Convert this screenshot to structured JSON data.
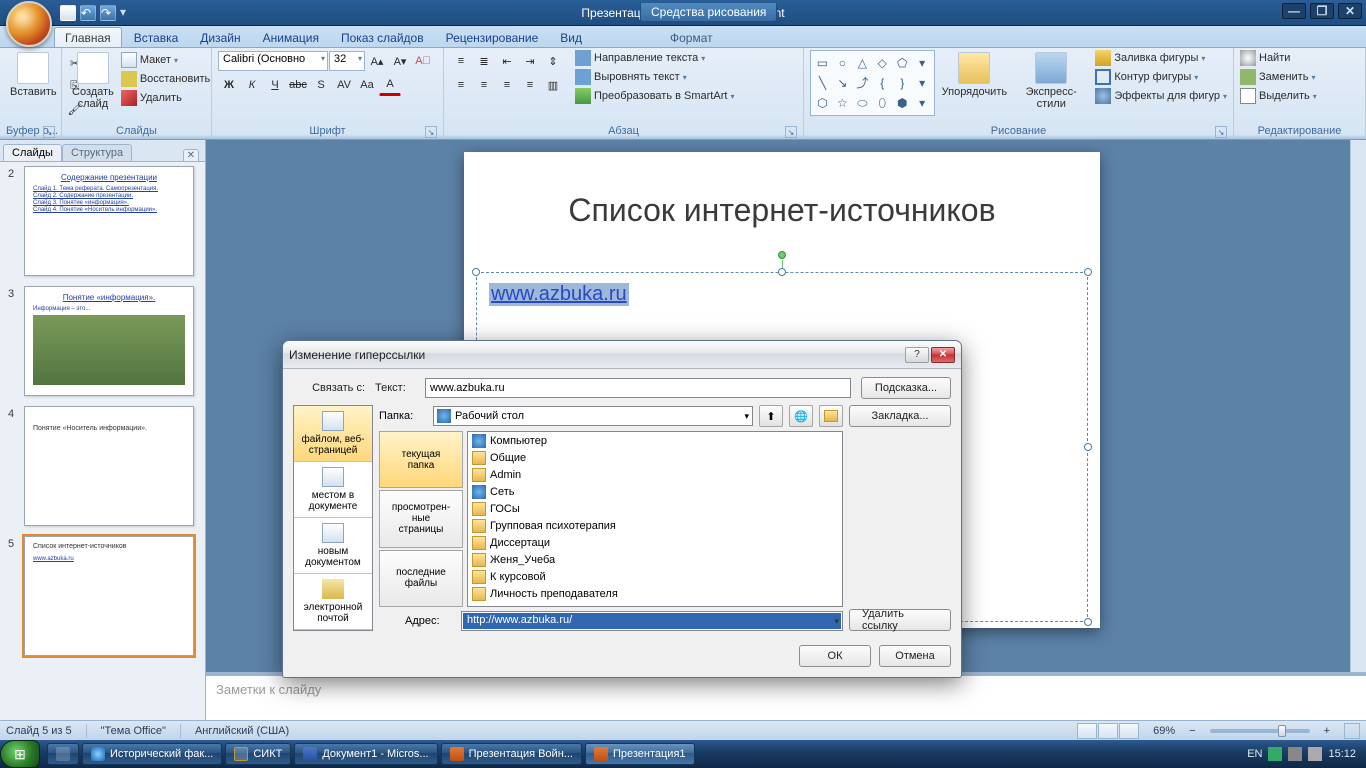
{
  "window": {
    "doc_title": "Презентация1 - Microsoft PowerPoint",
    "tool_context": "Средства рисования"
  },
  "tabs": {
    "home": "Главная",
    "insert": "Вставка",
    "design": "Дизайн",
    "animation": "Анимация",
    "slideshow": "Показ слайдов",
    "review": "Рецензирование",
    "view": "Вид",
    "format": "Формат"
  },
  "ribbon": {
    "paste": "Вставить",
    "clipboard_group": "Буфер о...",
    "new_slide": "Создать\nслайд",
    "layout": "Макет",
    "reset": "Восстановить",
    "delete": "Удалить",
    "slides_group": "Слайды",
    "font_name": "Calibri (Основно",
    "font_size": "32",
    "font_group": "Шрифт",
    "para_group": "Абзац",
    "text_direction": "Направление текста",
    "align_text": "Выровнять текст",
    "smartart": "Преобразовать в SmartArt",
    "arrange": "Упорядочить",
    "quick_styles": "Экспресс-стили",
    "shape_fill": "Заливка фигуры",
    "shape_outline": "Контур фигуры",
    "shape_effects": "Эффекты для фигур",
    "drawing_group": "Рисование",
    "find": "Найти",
    "replace": "Заменить",
    "select": "Выделить",
    "editing_group": "Редактирование"
  },
  "side": {
    "tab_slides": "Слайды",
    "tab_outline": "Структура",
    "thumbs": [
      {
        "num": "2",
        "title": "Содержание презентации",
        "lines": [
          "Слайд 1. Тема реферата. Самопрезентация.",
          "Слайд 2. Содержание презентации.",
          "Слайд 3. Понятие «информация».",
          "Слайд 4. Понятие «Носитель информации»."
        ]
      },
      {
        "num": "3",
        "title": "Понятие «информация».",
        "lines": [
          "Информация – это..."
        ]
      },
      {
        "num": "4",
        "title": "Понятие «Носитель информации».",
        "lines": []
      },
      {
        "num": "5",
        "title": "Список интернет-источников",
        "lines": [
          "www.azbuka.ru"
        ]
      }
    ]
  },
  "slide": {
    "title": "Список интернет-источников",
    "link_text": "www.azbuka.ru"
  },
  "notes_placeholder": "Заметки к слайду",
  "dialog": {
    "title": "Изменение гиперссылки",
    "link_to_label": "Связать с:",
    "text_label": "Текст:",
    "text_value": "www.azbuka.ru",
    "screentip": "Подсказка...",
    "places": {
      "file_web": "файлом, веб-\nстраницей",
      "doc_place": "местом в\nдокументе",
      "new_doc": "новым\nдокументом",
      "email": "электронной\nпочтой"
    },
    "folder_label": "Папка:",
    "folder_value": "Рабочий стол",
    "left_tabs": {
      "current": "текущая\nпапка",
      "browsed": "просмотрен-\nные\nстраницы",
      "recent": "последние\nфайлы"
    },
    "files": [
      "Компьютер",
      "Общие",
      "Admin",
      "Сеть",
      "ГОСы",
      "Групповая психотерапия",
      "Диссертаци",
      "Женя_Учеба",
      "К курсовой",
      "Личность преподавателя"
    ],
    "bookmark": "Закладка...",
    "remove": "Удалить ссылку",
    "addr_label": "Адрес:",
    "addr_value": "http://www.azbuka.ru/",
    "ok": "ОК",
    "cancel": "Отмена"
  },
  "status": {
    "slide_of": "Слайд 5 из 5",
    "theme": "\"Тема Office\"",
    "lang": "Английский (США)",
    "zoom": "69%"
  },
  "taskbar": {
    "items": [
      {
        "label": "Исторический фак..."
      },
      {
        "label": "СИКТ"
      },
      {
        "label": "Документ1 - Micros..."
      },
      {
        "label": "Презентация Войн..."
      },
      {
        "label": "Презентация1"
      }
    ],
    "lang": "EN",
    "time": "15:12"
  }
}
